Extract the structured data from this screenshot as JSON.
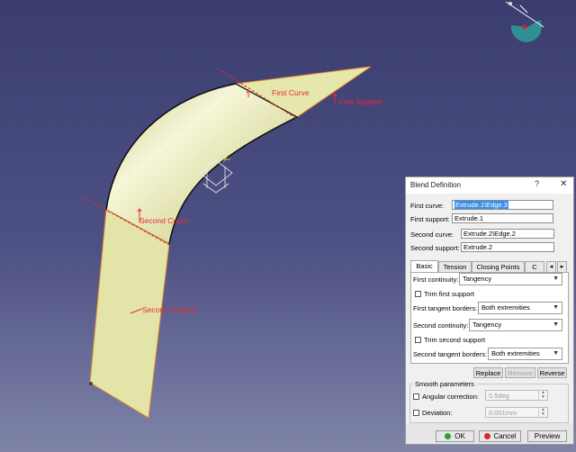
{
  "viewport": {
    "labels": {
      "first_curve": "First Curve",
      "first_support": "First Support",
      "second_curve": "Second Curve",
      "second_support": "Second Support"
    },
    "colors": {
      "surface": "#ecedb4",
      "label": "#e8283a",
      "background_top": "#3a3d6e",
      "background_bottom": "#7f84a8"
    }
  },
  "dialog": {
    "title": "Blend Definition",
    "help_glyph": "?",
    "close_glyph": "✕",
    "first_curve_label": "First curve:",
    "first_curve_value": "Extrude.1\\Edge.3",
    "first_support_label": "First support:",
    "first_support_value": "Extrude.1",
    "second_curve_label": "Second curve:",
    "second_curve_value": "Extrude.2\\Edge.2",
    "second_support_label": "Second support:",
    "second_support_value": "Extrude.2",
    "tabs": [
      "Basic",
      "Tension",
      "Closing Points",
      "C"
    ],
    "active_tab": "Basic",
    "first_continuity_label": "First continuity:",
    "first_continuity_value": "Tangency",
    "trim_first_label": "Trim first support",
    "trim_first_checked": false,
    "first_tangent_label": "First tangent borders:",
    "first_tangent_value": "Both extremities",
    "second_continuity_label": "Second continuity:",
    "second_continuity_value": "Tangency",
    "trim_second_label": "Trim second support",
    "trim_second_checked": false,
    "second_tangent_label": "Second tangent borders:",
    "second_tangent_value": "Both extremities",
    "replace_label": "Replace",
    "remove_label": "Remove",
    "reverse_label": "Reverse",
    "smooth_group_label": "Smooth parameters",
    "angular_label": "Angular correction:",
    "angular_value": "0.5deg",
    "angular_checked": false,
    "deviation_label": "Deviation:",
    "deviation_value": "0.001mm",
    "deviation_checked": false,
    "ok_label": "OK",
    "cancel_label": "Cancel",
    "preview_label": "Preview",
    "ok_color": "#2aa32a",
    "cancel_color": "#d42a2a"
  }
}
